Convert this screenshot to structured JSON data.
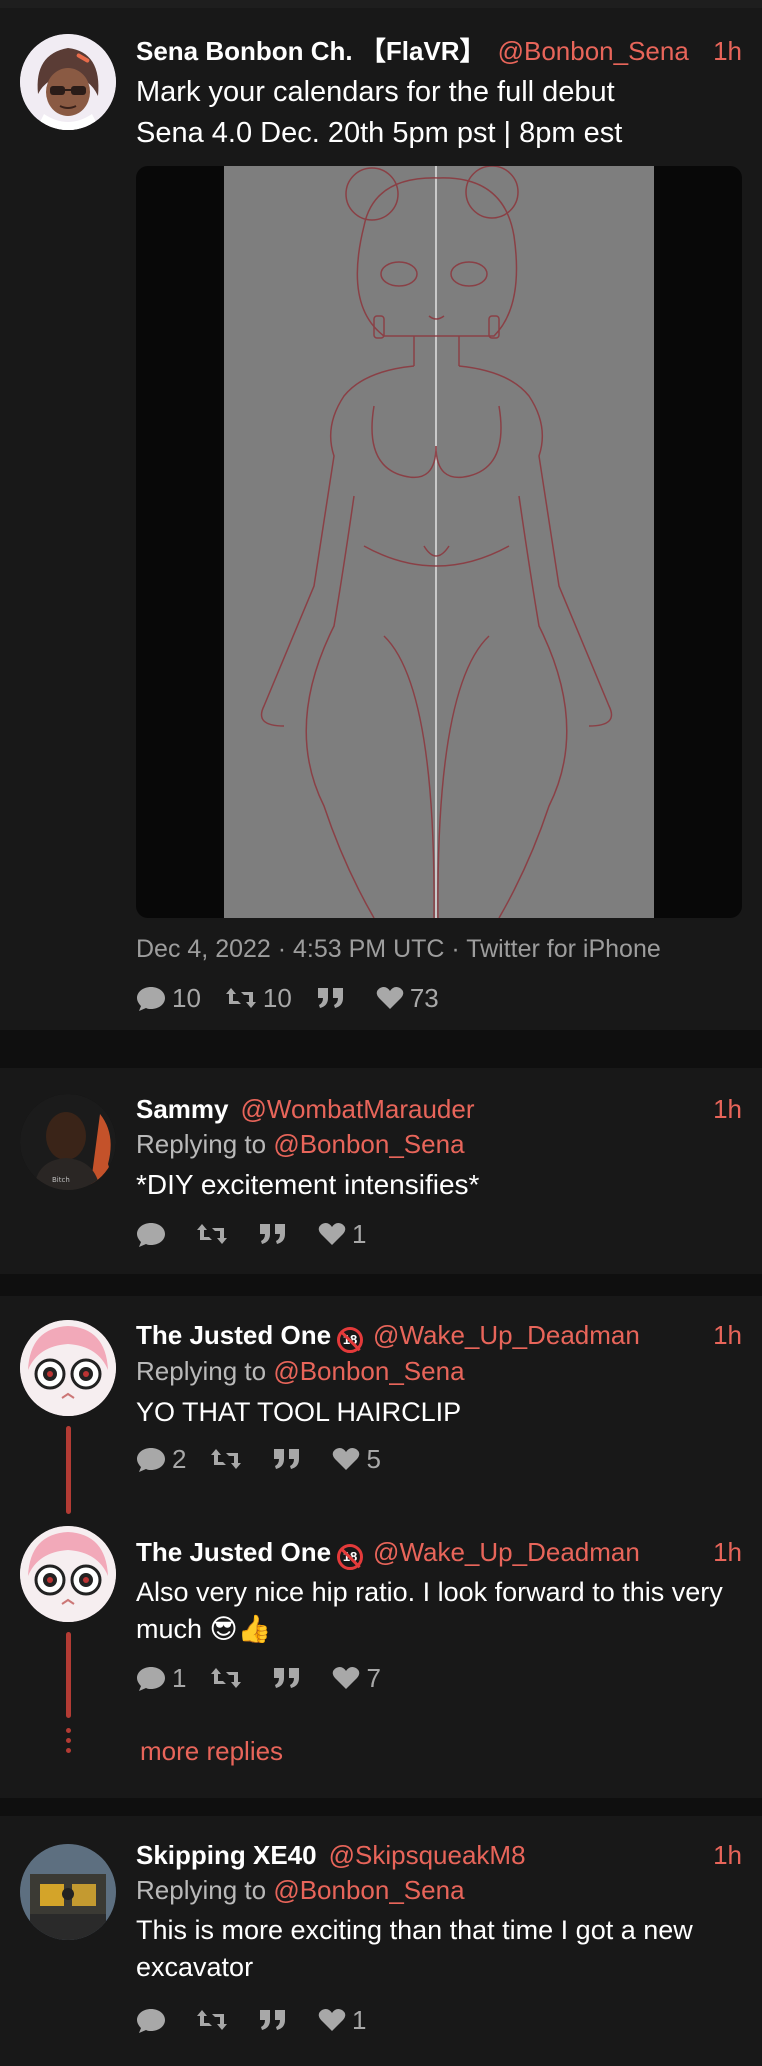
{
  "main_tweet": {
    "name": "Sena Bonbon Ch. 【FlaVR】",
    "handle": "@Bonbon_Sena",
    "time": "1h",
    "text_line1": "Mark your calendars for the full debut",
    "text_line2": "Sena 4.0 Dec. 20th 5pm pst | 8pm est",
    "meta": "Dec 4, 2022 · 4:53 PM UTC · Twitter for iPhone",
    "stats": {
      "replies": "10",
      "retweets": "10",
      "quotes": "",
      "likes": "73"
    }
  },
  "replies": [
    {
      "name": "Sammy",
      "handle": "@WombatMarauder",
      "time": "1h",
      "replying_label": "Replying to",
      "replying_to": "@Bonbon_Sena",
      "text": "*DIY excitement intensifies*",
      "stats": {
        "replies": "",
        "retweets": "",
        "quotes": "",
        "likes": "1"
      }
    },
    {
      "name": "The Justed One",
      "badge": "18",
      "handle": "@Wake_Up_Deadman",
      "time": "1h",
      "replying_label": "Replying to",
      "replying_to": "@Bonbon_Sena",
      "text": "YO THAT TOOL HAIRCLIP",
      "stats": {
        "replies": "2",
        "retweets": "",
        "quotes": "",
        "likes": "5"
      }
    },
    {
      "name": "The Justed One",
      "badge": "18",
      "handle": "@Wake_Up_Deadman",
      "time": "1h",
      "text_line1": "Also very nice hip ratio. I look forward to this very",
      "text_line2": "much 😎👍",
      "stats": {
        "replies": "1",
        "retweets": "",
        "quotes": "",
        "likes": "7"
      }
    },
    {
      "name": "Skipping XE40",
      "handle": "@SkipsqueakM8",
      "time": "1h",
      "replying_label": "Replying to",
      "replying_to": "@Bonbon_Sena",
      "text_line1": "This is more exciting than that time I got a new",
      "text_line2": "excavator",
      "stats": {
        "replies": "",
        "retweets": "",
        "quotes": "",
        "likes": "1"
      }
    }
  ],
  "more_replies": "more replies",
  "colors": {
    "accent": "#e8655a",
    "thread": "#b33b34",
    "card": "#181818",
    "bg": "#0f0f0f"
  }
}
